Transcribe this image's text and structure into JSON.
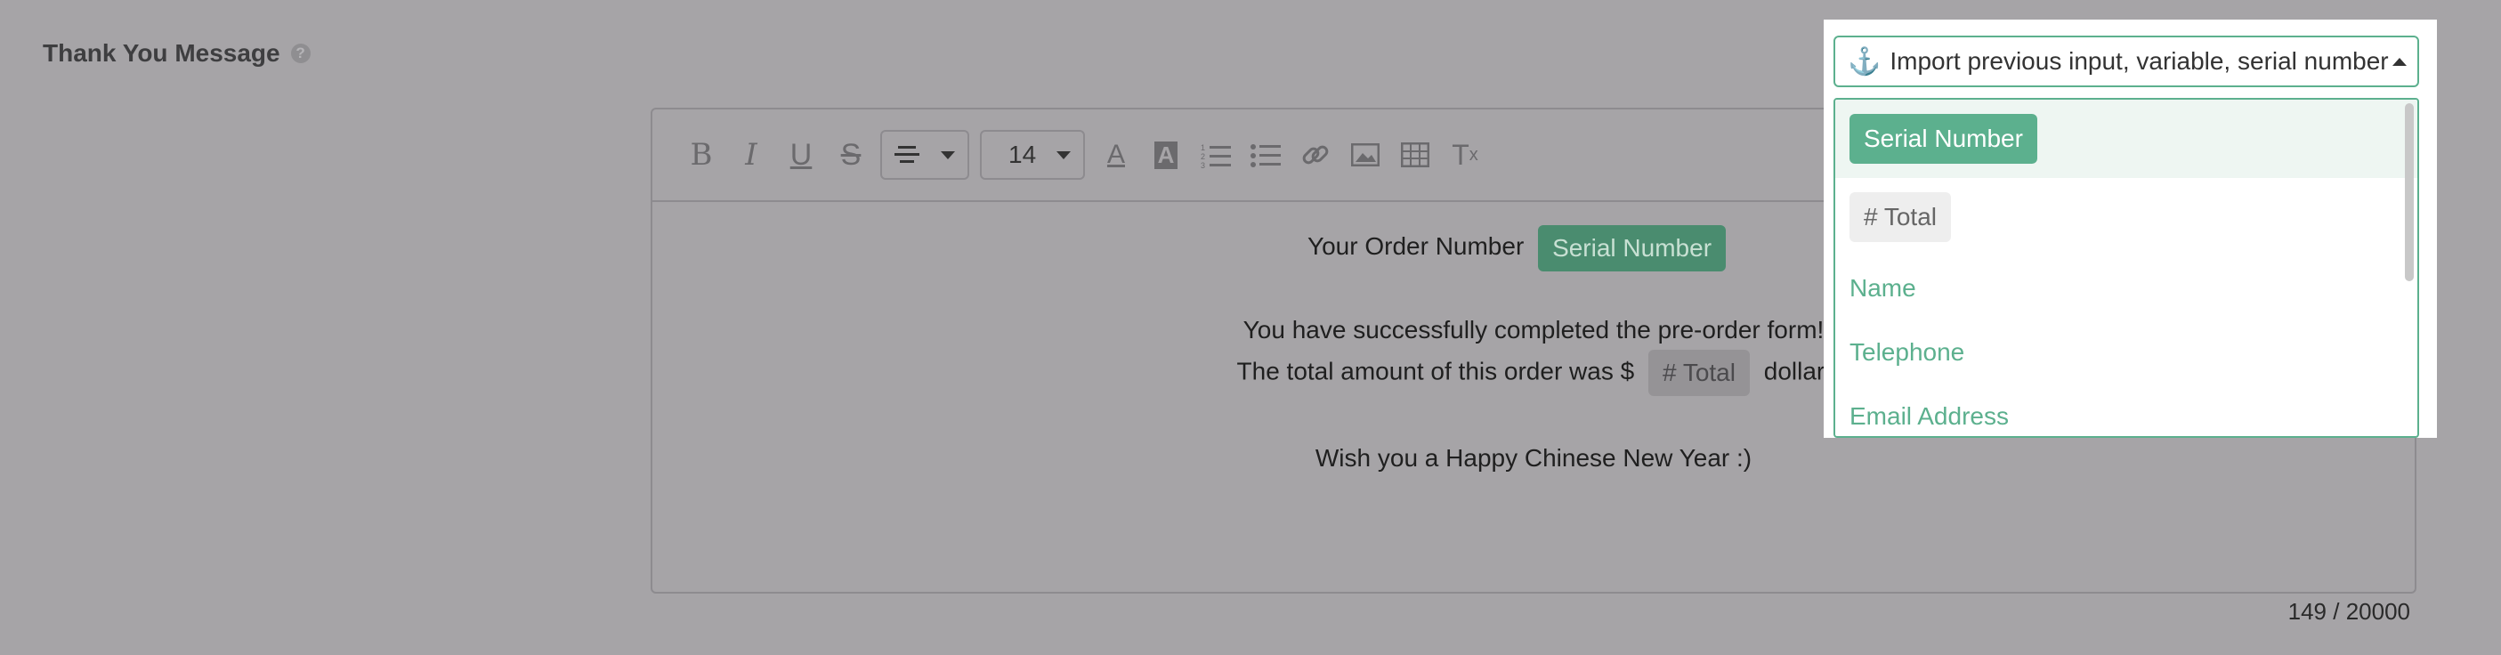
{
  "section": {
    "title": "Thank You Message",
    "help_icon": "question-circle-icon"
  },
  "toolbar": {
    "icons": [
      "bold-icon",
      "italic-icon",
      "underline-icon",
      "strikethrough-icon"
    ],
    "font_size": "14",
    "align_icon": "align-center-icon"
  },
  "editor": {
    "line1_text": "Your Order Number",
    "line1_chip": "Serial Number",
    "line2_text": "You have successfully completed the pre-order form!",
    "line3_before": "The total amount of this order was $",
    "line3_chip": "# Total",
    "line3_after": "dollar.",
    "line4_text": "Wish you a Happy Chinese New Year :)"
  },
  "counter": "149 / 20000",
  "import": {
    "label": "Import previous input, variable, serial number",
    "options": [
      {
        "label": "Serial Number",
        "kind": "variable-chip"
      },
      {
        "label": "# Total",
        "kind": "number-chip"
      },
      {
        "label": "Name",
        "kind": "field"
      },
      {
        "label": "Telephone",
        "kind": "field"
      },
      {
        "label": "Email Address",
        "kind": "field"
      }
    ]
  },
  "colors": {
    "accent": "#5cb08e",
    "overlay": "#a6a4a7"
  }
}
